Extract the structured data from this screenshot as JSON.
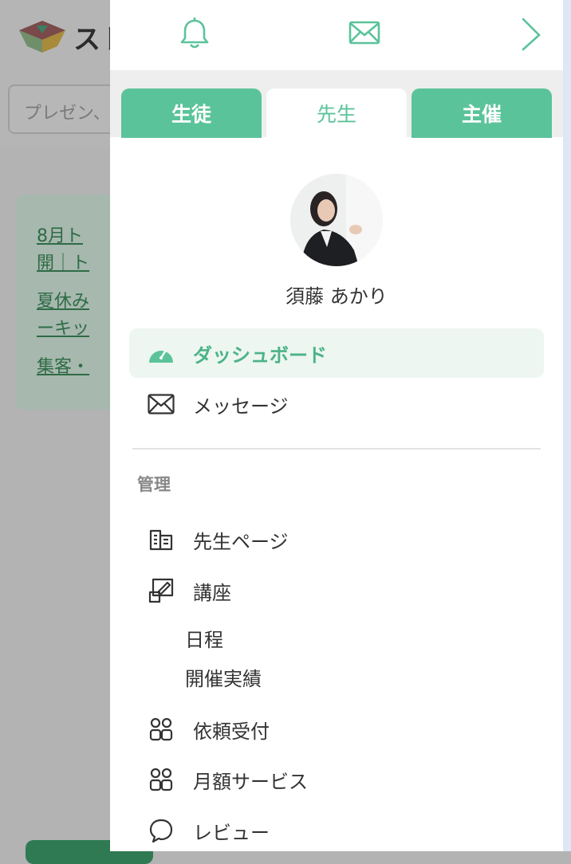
{
  "background": {
    "logo_text": "スト",
    "search_placeholder": "プレゼン、",
    "links": [
      "8月ト",
      "開｜ト",
      "夏休み",
      "ーキッ",
      "集客・"
    ]
  },
  "drawer": {
    "topbar": {
      "icons": [
        "bell-icon",
        "mail-icon",
        "chevron-right-icon"
      ],
      "accent": "#5bc39a"
    },
    "tabs": [
      {
        "label": "生徒",
        "active": false
      },
      {
        "label": "先生",
        "active": true
      },
      {
        "label": "主催",
        "active": false
      }
    ],
    "profile": {
      "name": "須藤 あかり"
    },
    "nav_primary": [
      {
        "label": "ダッシュボード",
        "icon": "dashboard-icon",
        "active": true
      },
      {
        "label": "メッセージ",
        "icon": "mail-icon",
        "active": false
      }
    ],
    "section_label": "管理",
    "nav_manage": [
      {
        "label": "先生ページ",
        "icon": "building-icon"
      },
      {
        "label": "講座",
        "icon": "course-edit-icon"
      },
      {
        "label": "日程"
      },
      {
        "label": "開催実績"
      },
      {
        "label": "依頼受付",
        "icon": "users-icon"
      },
      {
        "label": "月額サービス",
        "icon": "users-icon"
      },
      {
        "label": "レビュー",
        "icon": "chat-bubble-icon"
      }
    ]
  }
}
